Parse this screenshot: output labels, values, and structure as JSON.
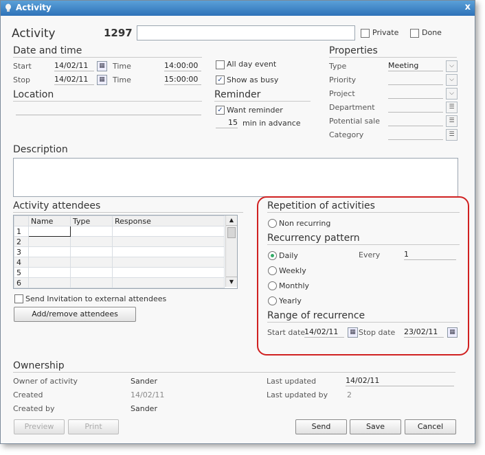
{
  "window": {
    "title": "Activity",
    "close": "x"
  },
  "header": {
    "title": "Activity",
    "number": "1297",
    "subject": "",
    "private_label": "Private",
    "done_label": "Done"
  },
  "datetime": {
    "heading": "Date and time",
    "start_label": "Start",
    "start_date": "14/02/11",
    "start_time_label": "Time",
    "start_time": "14:00:00",
    "stop_label": "Stop",
    "stop_date": "14/02/11",
    "stop_time_label": "Time",
    "stop_time": "15:00:00"
  },
  "options": {
    "all_day": "All day event",
    "show_busy": "Show as busy"
  },
  "reminder": {
    "heading": "Reminder",
    "want_reminder": "Want reminder",
    "minutes": "15",
    "minutes_label": "min in advance"
  },
  "location": {
    "heading": "Location",
    "value": ""
  },
  "properties": {
    "heading": "Properties",
    "rows": [
      {
        "label": "Type",
        "value": "Meeting",
        "control": "dropdown"
      },
      {
        "label": "Priority",
        "value": "",
        "control": "dropdown"
      },
      {
        "label": "Project",
        "value": "",
        "control": "dropdown"
      },
      {
        "label": "Department",
        "value": "",
        "control": "list"
      },
      {
        "label": "Potential sale",
        "value": "",
        "control": "list"
      },
      {
        "label": "Category",
        "value": "",
        "control": "list"
      }
    ]
  },
  "description": {
    "heading": "Description",
    "value": ""
  },
  "attendees": {
    "heading": "Activity attendees",
    "columns": [
      "Name",
      "Type",
      "Response"
    ],
    "rows": [
      "1",
      "2",
      "3",
      "4",
      "5",
      "6"
    ],
    "send_invitation": "Send Invitation to external attendees",
    "add_remove": "Add/remove attendees"
  },
  "repetition": {
    "heading": "Repetition of activities",
    "non_recurring": "Non recurring",
    "pattern_heading": "Recurrency pattern",
    "daily": "Daily",
    "weekly": "Weekly",
    "monthly": "Monthly",
    "yearly": "Yearly",
    "every_label": "Every",
    "every_value": "1",
    "range_heading": "Range of recurrence",
    "start_label": "Start date",
    "start_value": "14/02/11",
    "stop_label": "Stop date",
    "stop_value": "23/02/11",
    "selected": "Daily"
  },
  "ownership": {
    "heading": "Ownership",
    "owner_label": "Owner of activity",
    "owner_value": "Sander",
    "created_label": "Created",
    "created_value": "14/02/11",
    "created_by_label": "Created by",
    "created_by_value": "Sander",
    "last_updated_label": "Last updated",
    "last_updated_value": "14/02/11",
    "last_updated_by_label": "Last updated by",
    "last_updated_by_value": "2"
  },
  "buttons": {
    "preview": "Preview",
    "print": "Print",
    "send": "Send",
    "save": "Save",
    "cancel": "Cancel"
  },
  "colors": {
    "highlight": "#d02020",
    "title_bar": "#2e72b8"
  }
}
